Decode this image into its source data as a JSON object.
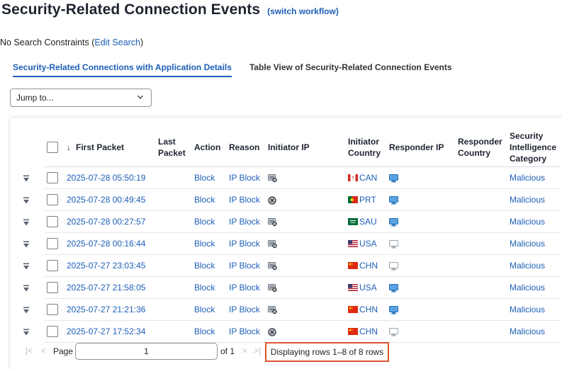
{
  "header": {
    "title": "Security-Related Connection Events",
    "switch_link": "(switch workflow)"
  },
  "constraints": {
    "prefix": "No Search Constraints (",
    "link": "Edit Search",
    "suffix": ")"
  },
  "tabs": [
    {
      "label": "Security-Related Connections with Application Details",
      "active": true
    },
    {
      "label": "Table View of Security-Related Connection Events",
      "active": false
    }
  ],
  "jump": {
    "label": "Jump to...",
    "icon": "chevron-down-icon"
  },
  "table": {
    "columns": {
      "first_packet": "First Packet",
      "last_packet": "Last Packet",
      "action": "Action",
      "reason": "Reason",
      "initiator_ip": "Initiator IP",
      "initiator_country": "Initiator Country",
      "responder_ip": "Responder IP",
      "responder_country": "Responder Country",
      "si_category": "Security Intelligence Category"
    },
    "sort_icon": "arrow-down-icon",
    "rows": [
      {
        "first_packet": "2025-07-28 05:50:19",
        "action": "Block",
        "reason": "IP Block",
        "host_icon": "host-blocked-icon",
        "flag": "flag-canada-icon",
        "country": "CAN",
        "monitor": "monitor-blue-icon",
        "category": "Malicious"
      },
      {
        "first_packet": "2025-07-28 00:49:45",
        "action": "Block",
        "reason": "IP Block",
        "host_icon": "host-circle-icon",
        "flag": "flag-portugal-icon",
        "country": "PRT",
        "monitor": "monitor-blue-icon",
        "category": "Malicious"
      },
      {
        "first_packet": "2025-07-28 00:27:57",
        "action": "Block",
        "reason": "IP Block",
        "host_icon": "host-blocked-icon",
        "flag": "flag-saudi-arabia-icon",
        "country": "SAU",
        "monitor": "monitor-blue-icon",
        "category": "Malicious"
      },
      {
        "first_packet": "2025-07-28 00:16:44",
        "action": "Block",
        "reason": "IP Block",
        "host_icon": "host-blocked-icon",
        "flag": "flag-usa-icon",
        "country": "USA",
        "monitor": "monitor-grey-icon",
        "category": "Malicious"
      },
      {
        "first_packet": "2025-07-27 23:03:45",
        "action": "Block",
        "reason": "IP Block",
        "host_icon": "host-blocked-icon",
        "flag": "flag-china-icon",
        "country": "CHN",
        "monitor": "monitor-grey-icon",
        "category": "Malicious"
      },
      {
        "first_packet": "2025-07-27 21:58:05",
        "action": "Block",
        "reason": "IP Block",
        "host_icon": "host-blocked-icon",
        "flag": "flag-usa-icon",
        "country": "USA",
        "monitor": "monitor-blue-icon",
        "category": "Malicious"
      },
      {
        "first_packet": "2025-07-27 21:21:36",
        "action": "Block",
        "reason": "IP Block",
        "host_icon": "host-blocked-icon",
        "flag": "flag-china-icon",
        "country": "CHN",
        "monitor": "monitor-blue-icon",
        "category": "Malicious"
      },
      {
        "first_packet": "2025-07-27 17:52:34",
        "action": "Block",
        "reason": "IP Block",
        "host_icon": "host-circle-icon",
        "flag": "flag-china-icon",
        "country": "CHN",
        "monitor": "monitor-grey-icon",
        "category": "Malicious"
      }
    ]
  },
  "pagination": {
    "page_label": "Page",
    "page_value": "1",
    "of_label": "of 1",
    "status": "Displaying rows 1–8 of 8 rows"
  }
}
